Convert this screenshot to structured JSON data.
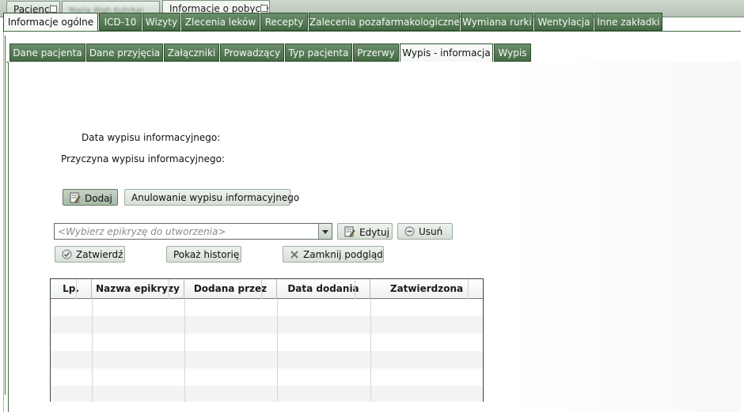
{
  "top_tabs": [
    {
      "label": "Pacjenci"
    },
    {
      "label": "Maria Wgh Kuhrkai"
    },
    {
      "label": "Informacje o pobycie"
    }
  ],
  "level1_tabs": [
    {
      "label": "Informacje ogólne"
    },
    {
      "label": "ICD-10"
    },
    {
      "label": "Wizyty"
    },
    {
      "label": "Zlecenia leków"
    },
    {
      "label": "Recepty"
    },
    {
      "label": "Zalecenia pozafarmakologiczne"
    },
    {
      "label": "Wymiana rurki"
    },
    {
      "label": "Wentylacja"
    },
    {
      "label": "Inne zakładki"
    }
  ],
  "level2_tabs": [
    {
      "label": "Dane pacjenta"
    },
    {
      "label": "Dane przyjęcia"
    },
    {
      "label": "Załączniki"
    },
    {
      "label": "Prowadzący"
    },
    {
      "label": "Typ pacjenta"
    },
    {
      "label": "Przerwy"
    },
    {
      "label": "Wypis - informacja"
    },
    {
      "label": "Wypis"
    }
  ],
  "form": {
    "data_label": "Data wypisu informacyjnego:",
    "reason_label": "Przyczyna wypisu informacyjnego:"
  },
  "buttons": {
    "add": "Dodaj",
    "cancel_info": "Anulowanie wypisu informacyjnego",
    "edit": "Edytuj",
    "remove": "Usuń",
    "approve": "Zatwierdź",
    "history": "Pokaż historię",
    "close_preview": "Zamknij podgląd"
  },
  "epikryza_select": {
    "placeholder": "<Wybierz epikryzę do utworzenia>"
  },
  "table": {
    "columns": [
      "Lp.",
      "Nazwa epikryzy",
      "Dodana przez",
      "Data dodania",
      "Zatwierdzona"
    ],
    "rows": []
  },
  "icons": {
    "add": "edit-document-icon",
    "edit": "edit-document-icon",
    "remove": "minus-circle-icon",
    "approve": "check-circle-icon",
    "close_preview": "x-mark-icon",
    "dropdown": "chevron-down-icon",
    "tab_close": "close-box-icon"
  },
  "colors": {
    "tab_green": "#4f744f",
    "tab_text": "#f3f7f3",
    "button_bg": "#dfe6df",
    "table_border": "#3a4a3a"
  }
}
